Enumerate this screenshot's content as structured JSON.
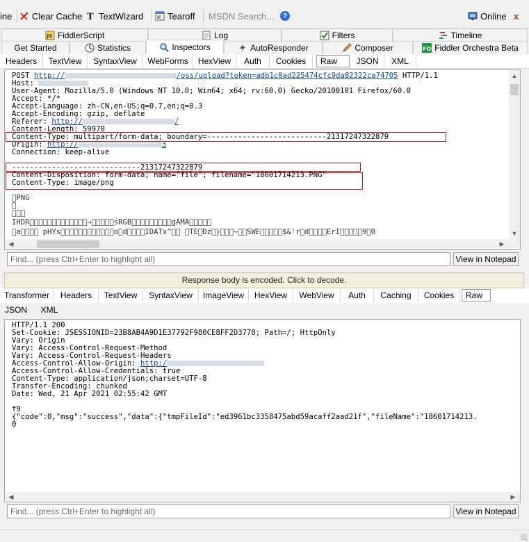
{
  "toolbar": {
    "line_label": "ine",
    "clear_cache": "Clear Cache",
    "textwizard": "TextWizard",
    "tearoff": "Tearoff",
    "msdn_placeholder": "MSDN Search...",
    "online": "Online",
    "close": "x"
  },
  "tabs_row1": [
    "FiddlerScript",
    "Log",
    "Filters",
    "Timeline"
  ],
  "tabs_row2": [
    "Get Started",
    "Statistics",
    "Inspectors",
    "AutoResponder",
    "Composer",
    "Fiddler Orchestra Beta"
  ],
  "request_tabs": [
    "Headers",
    "TextView",
    "SyntaxView",
    "WebForms",
    "HexView",
    "Auth",
    "Cookies",
    "Raw",
    "JSON",
    "XML"
  ],
  "request": {
    "line1_method": "POST",
    "line1_url_prefix": "http://",
    "line1_url_suffix": "/oss/upload?token=adb1c0ad225474cfc9da82322ca74705",
    "line1_proto": "HTTP/1.1",
    "host": "Host: ",
    "user_agent": "User-Agent: Mozilla/5.0 (Windows NT 10.0; Win64; x64; rv:60.0) Gecko/20100101 Firefox/60.0",
    "accept": "Accept: */*",
    "accept_language": "Accept-Language: zh-CN,en-US;q=0.7,en;q=0.3",
    "accept_encoding": "Accept-Encoding: gzip, deflate",
    "referer_label": "Referer: ",
    "referer_url_prefix": "http://",
    "referer_url_suffix": "/",
    "content_length": "Content-Length: 59970",
    "content_type": "Content-Type: multipart/form-data; boundary=---------------------------21317247322879",
    "origin_label": "Origin: ",
    "origin_url_prefix": "http://",
    "origin_url_suffix": "3",
    "connection": "Connection: keep-alive",
    "boundary": "-----------------------------21317247322879",
    "disposition": "Content-Disposition: form-data; name=\"file\"; filename=\"18601714213.PNG\"",
    "part_type": "Content-Type: image/png",
    "png_1": "\u0000PNG",
    "png_2": "\u0000",
    "png_3": "\u0000\u0000\u0000",
    "png_4": "IHDR\u0000\u0000\u0000\u0000\u0000\u0000\u0000\u0000\u0000\u0000\u0000\u0000\u0000→\u0000\u0000\u0000\u0000\u0000sRGB\u0000\u0000\u0000\u0000\u0000\u0000\u0000\u0000\u0000gAMA\u0000\u0000\u0000\u0000\u0000",
    "png_5": "\u0000a\u0000\u0000\u0000\u0000 pHYs\u0000\u0000\u0000\u0000\u0000\u0000\u0000\u0000\u0000\u0000\u0000\u0000o\u0000d\u0000\u0000\u0000\u0000IDATx^\u0000\u0000 \u0000TE\u0000Ðz\u0000}\u0000\u0000\u0000~\u0000\u0000SWE\u0000\u0000\u0000\u0000\u0000$&'r\u0000d\u0000\u0000\u0000\u0000ErI\u0000\u0000\u0000\u0000\u00009\u00000"
  },
  "find_placeholder": "Find... (press Ctrl+Enter to highlight all)",
  "view_in_notepad": "View in Notepad",
  "banner": "Response body is encoded. Click to decode.",
  "response_tabs_row1": [
    "Transformer",
    "Headers",
    "TextView",
    "SyntaxView",
    "ImageView",
    "HexView",
    "WebView",
    "Auth",
    "Caching",
    "Cookies",
    "Raw"
  ],
  "response_tabs_row2": [
    "JSON",
    "XML"
  ],
  "response": {
    "status": "HTTP/1.1 200",
    "set_cookie": "Set-Cookie: JSESSIONID=23B8AB4A9D1E37792F980CE8FF2D3778; Path=/; HttpOnly",
    "vary1": "Vary: Origin",
    "vary2": "Vary: Access-Control-Request-Method",
    "vary3": "Vary: Access-Control-Request-Headers",
    "acao_label": "Access-Control-Allow-Origin: ",
    "acao_url_prefix": "http:/",
    "acac": "Access-Control-Allow-Credentials: true",
    "content_type": "Content-Type: application/json;charset=UTF-8",
    "transfer_encoding": "Transfer-Encoding: chunked",
    "date": "Date: Wed, 21 Apr 2021 02:55:42 GMT",
    "chunk_size": "f9",
    "body": "{\"code\":0,\"msg\":\"success\",\"data\":{\"tmpFileId\":\"ed3961bc3358475abd59acaff2aad21f\",\"fileName\":\"18601714213.",
    "chunk_end": "0"
  },
  "colors": {
    "highlight_border": "#cc1111",
    "link": "#0645ad",
    "banner_bg": "#f1f0dc"
  }
}
